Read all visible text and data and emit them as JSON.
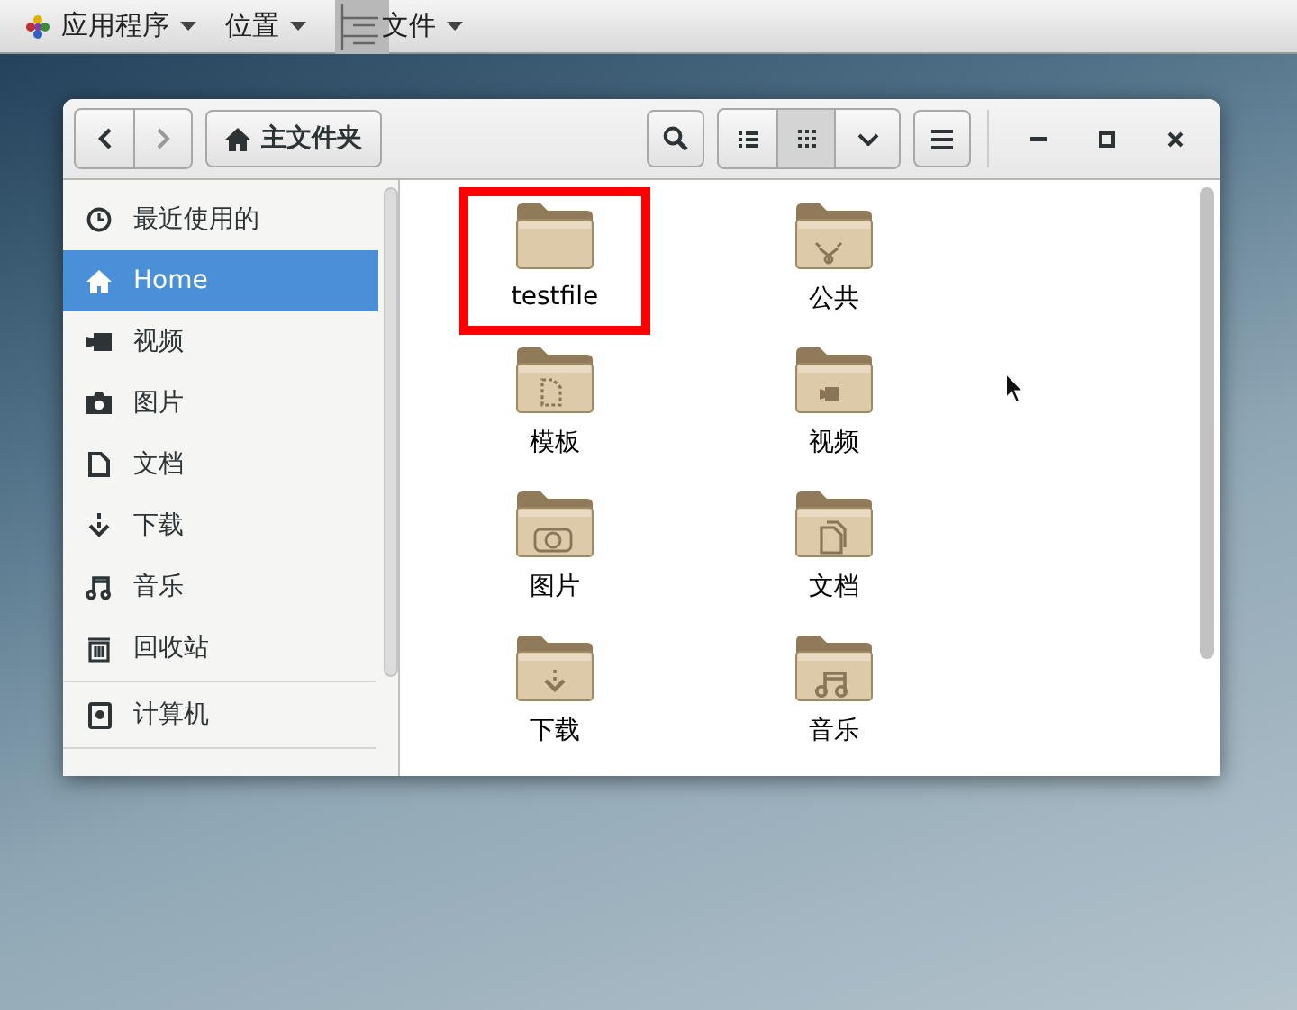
{
  "top_panel": {
    "menus": [
      {
        "label": "应用程序",
        "kind": "apps"
      },
      {
        "label": "位置",
        "kind": "plain"
      },
      {
        "label": "文件",
        "kind": "window"
      }
    ]
  },
  "window": {
    "path_button": "主文件夹",
    "view_buttons": [
      {
        "kind": "list",
        "selected": false
      },
      {
        "kind": "grid",
        "selected": true
      }
    ]
  },
  "sidebar": {
    "items": [
      {
        "label": "最近使用的",
        "kind": "recent",
        "selected": false
      },
      {
        "label": "Home",
        "kind": "home",
        "selected": true
      },
      {
        "label": "视频",
        "kind": "video",
        "selected": false
      },
      {
        "label": "图片",
        "kind": "picture",
        "selected": false
      },
      {
        "label": "文档",
        "kind": "document",
        "selected": false
      },
      {
        "label": "下载",
        "kind": "download",
        "selected": false
      },
      {
        "label": "音乐",
        "kind": "music",
        "selected": false
      },
      {
        "label": "回收站",
        "kind": "trash",
        "selected": false
      },
      {
        "label": "计算机",
        "kind": "computer",
        "selected": false,
        "divider_before": true,
        "divider_after": true
      }
    ]
  },
  "files": [
    {
      "name": "testfile",
      "kind": "plain",
      "highlighted": true
    },
    {
      "name": "公共",
      "kind": "share",
      "highlighted": false
    },
    {
      "name": "模板",
      "kind": "template",
      "highlighted": false
    },
    {
      "name": "视频",
      "kind": "video",
      "highlighted": false
    },
    {
      "name": "图片",
      "kind": "picture",
      "highlighted": false
    },
    {
      "name": "文档",
      "kind": "document",
      "highlighted": false
    },
    {
      "name": "下载",
      "kind": "download",
      "highlighted": false
    },
    {
      "name": "音乐",
      "kind": "music",
      "highlighted": false
    }
  ]
}
